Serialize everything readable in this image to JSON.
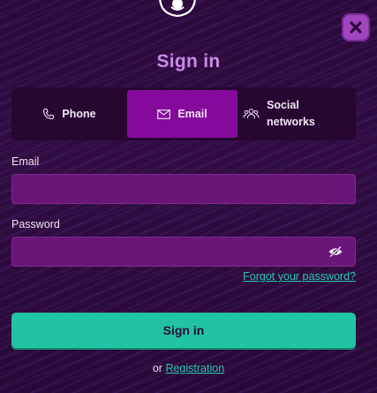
{
  "header": {
    "title": "Sign in",
    "close_icon": "close-icon",
    "logo_icon": "logo-icon"
  },
  "tabs": [
    {
      "label": "Phone",
      "icon": "phone-icon",
      "active": false
    },
    {
      "label": "Email",
      "icon": "envelope-icon",
      "active": true
    },
    {
      "label": "Social networks",
      "icon": "people-icon",
      "active": false
    }
  ],
  "form": {
    "email_label": "Email",
    "email_value": "",
    "password_label": "Password",
    "password_value": "",
    "eye_icon": "eye-slash-icon",
    "forgot_link": "Forgot your password?",
    "submit_label": "Sign in"
  },
  "footer": {
    "prefix": "or",
    "registration_link": "Registration"
  },
  "colors": {
    "background": "#2a0938",
    "accent": "#850a9c",
    "primary_button": "#21c3a4",
    "title": "#c98be6",
    "link": "#27c8aa"
  }
}
